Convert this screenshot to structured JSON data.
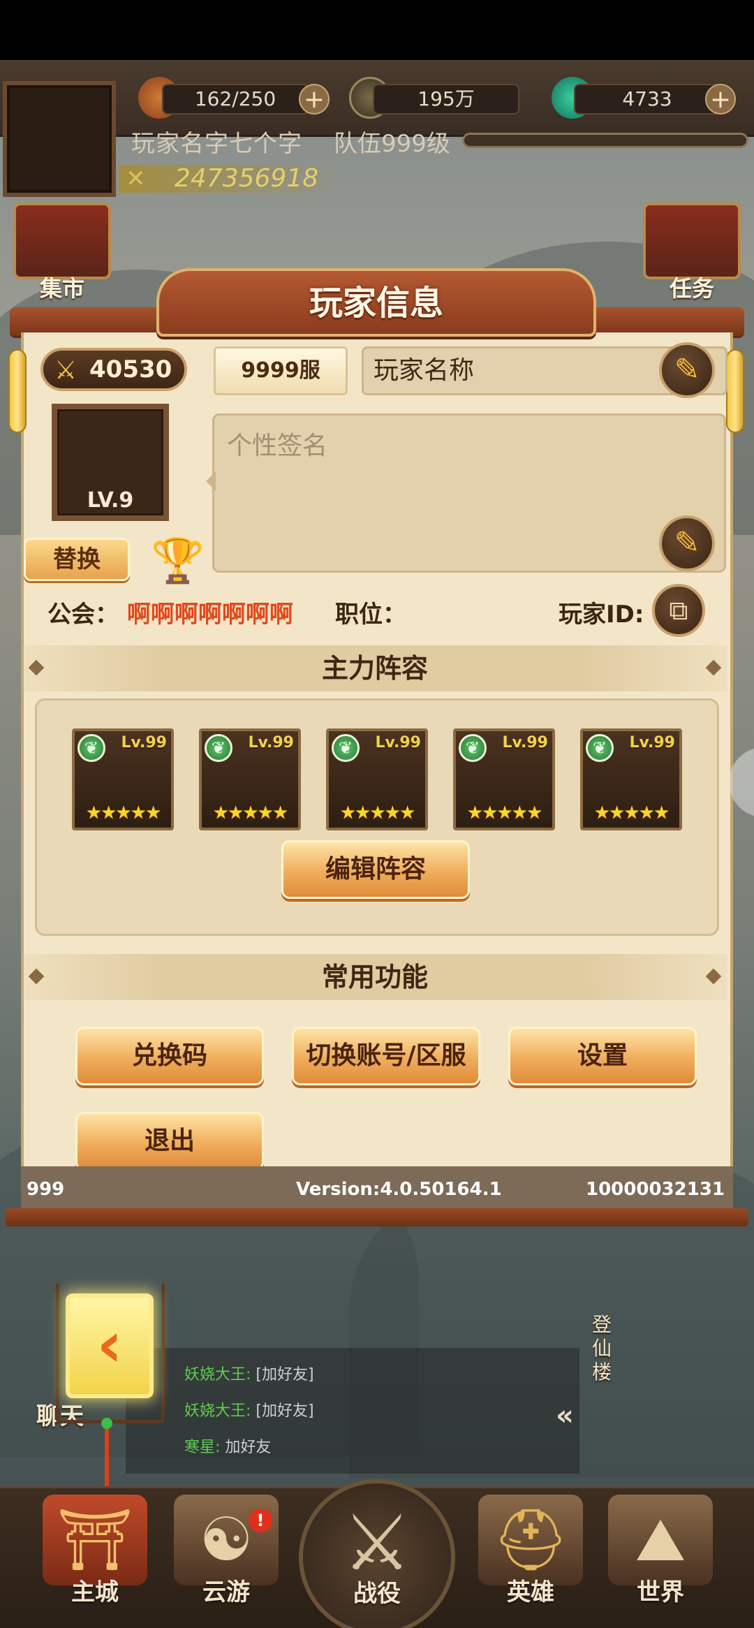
{
  "hud": {
    "stamina": "162/250",
    "coins": "195万",
    "gems": "4733",
    "player_name": "玩家名字七个字",
    "team_level": "队伍999级",
    "exp_progress": 0.0,
    "power_display": "247356918",
    "left_building": "集市",
    "right_building": "任务"
  },
  "dialog": {
    "title": "玩家信息",
    "power": "40530",
    "server": "9999服",
    "name_placeholder": "玩家名称",
    "level": "LV.9",
    "signature_placeholder": "个性签名",
    "swap_label": "替换",
    "guild_label": "公会：",
    "guild_name": "啊啊啊啊啊啊啊",
    "position_label": "职位：",
    "player_id_label": "玩家ID:",
    "lineup_title": "主力阵容",
    "heroes": [
      {
        "level": "Lv.99",
        "stars": 5
      },
      {
        "level": "Lv.99",
        "stars": 5
      },
      {
        "level": "Lv.99",
        "stars": 5
      },
      {
        "level": "Lv.99",
        "stars": 5
      },
      {
        "level": "Lv.99",
        "stars": 5
      }
    ],
    "edit_lineup_label": "编辑阵容",
    "functions_title": "常用功能",
    "redeem_label": "兑换码",
    "switch_account_label": "切换账号/区服",
    "settings_label": "设置",
    "logout_label": "退出",
    "footer_left": "999",
    "version": "Version:4.0.50164.1",
    "footer_right": "10000032131"
  },
  "chat": {
    "label": "聊天",
    "messages": [
      {
        "name": "妖娆大王:",
        "text": "[加好友]"
      },
      {
        "name": "妖娆大王:",
        "text": "[加好友]"
      },
      {
        "name": "寒星:",
        "text": "加好友"
      }
    ],
    "tower_label": "登仙楼"
  },
  "nav": {
    "items": [
      "主城",
      "云游",
      "战役",
      "英雄",
      "世界"
    ],
    "badge": "!"
  }
}
